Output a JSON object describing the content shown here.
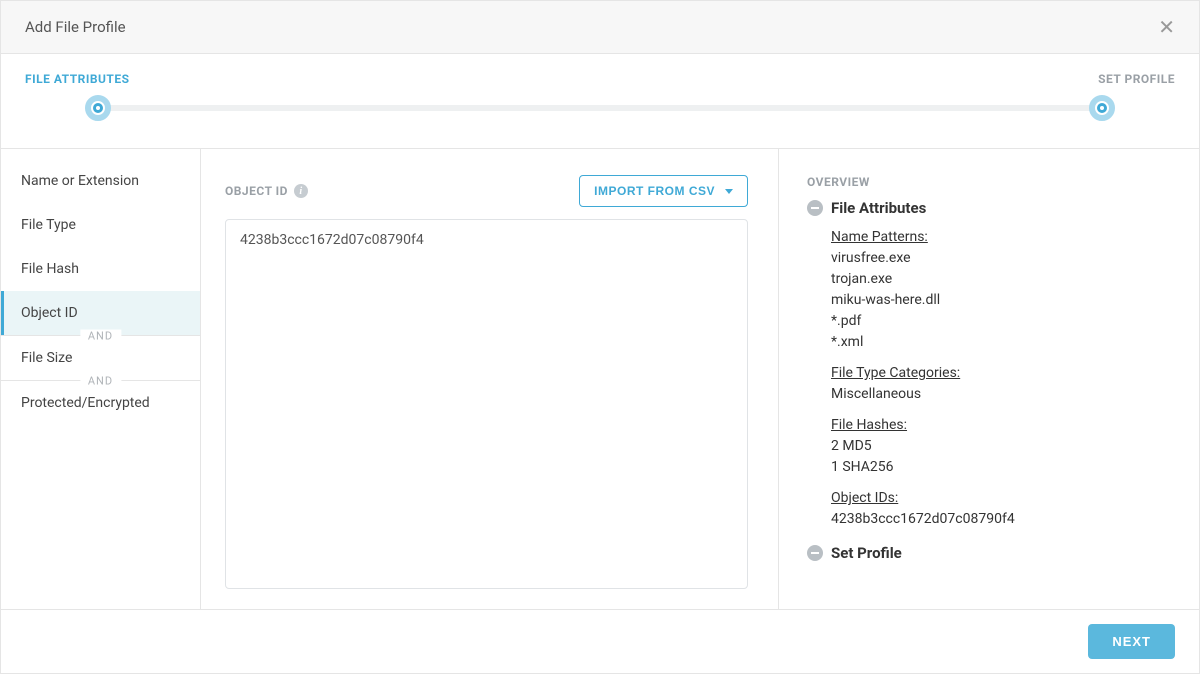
{
  "header": {
    "title": "Add File Profile"
  },
  "stepper": {
    "left": "FILE ATTRIBUTES",
    "right": "SET PROFILE"
  },
  "sidebar": {
    "items": [
      {
        "label": "Name or Extension"
      },
      {
        "label": "File Type"
      },
      {
        "label": "File Hash"
      },
      {
        "label": "Object ID"
      },
      {
        "label": "File Size"
      },
      {
        "label": "Protected/Encrypted"
      }
    ],
    "and": "AND"
  },
  "main": {
    "field_label": "OBJECT ID",
    "import_label": "IMPORT FROM CSV",
    "value": "4238b3ccc1672d07c08790f4"
  },
  "overview": {
    "title": "OVERVIEW",
    "section_attributes": "File Attributes",
    "name_patterns_label": "Name Patterns:",
    "name_patterns": [
      "virusfree.exe",
      "trojan.exe",
      "miku-was-here.dll",
      "*.pdf",
      "*.xml"
    ],
    "file_type_label": "File Type Categories:",
    "file_type_values": [
      "Miscellaneous"
    ],
    "file_hashes_label": "File Hashes:",
    "file_hashes": [
      "2 MD5",
      "1 SHA256"
    ],
    "object_ids_label": "Object IDs:",
    "object_ids": [
      "4238b3ccc1672d07c08790f4"
    ],
    "section_profile": "Set Profile"
  },
  "footer": {
    "next": "NEXT"
  }
}
